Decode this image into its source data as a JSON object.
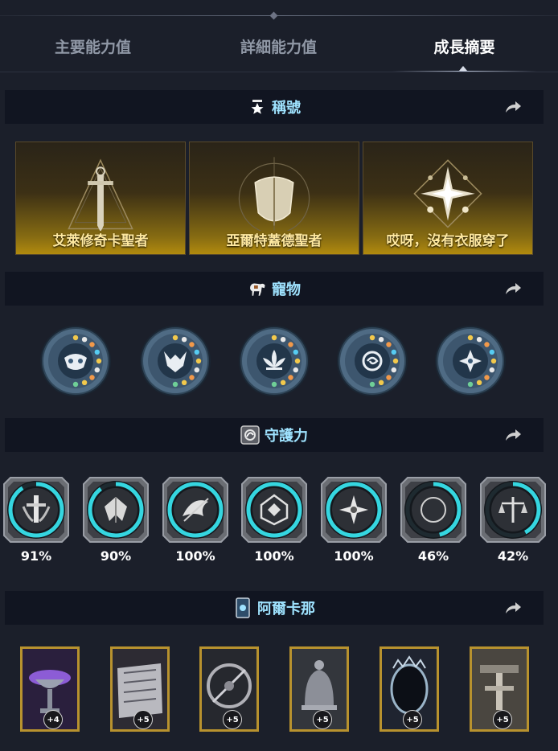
{
  "tabs": [
    {
      "label": "主要能力值",
      "active": false
    },
    {
      "label": "詳細能力值",
      "active": false
    },
    {
      "label": "成長摘要",
      "active": true
    }
  ],
  "sections": {
    "titles": {
      "label": "稱號",
      "icon": "star-medal-icon"
    },
    "pets": {
      "label": "寵物",
      "icon": "horse-icon"
    },
    "guardian": {
      "label": "守護力",
      "icon": "guardian-rune-icon"
    },
    "arkana": {
      "label": "阿爾卡那",
      "icon": "card-icon"
    }
  },
  "titles": [
    {
      "label": "艾萊修奇卡聖者",
      "icon": "sword-triangle-emblem-icon"
    },
    {
      "label": "亞爾特蓋德聖者",
      "icon": "shield-emblem-icon"
    },
    {
      "label": "哎呀，沒有衣服穿了",
      "icon": "compass-star-emblem-icon"
    }
  ],
  "pets": [
    {
      "icon": "owl-mask-pet-icon"
    },
    {
      "icon": "wolf-pet-icon"
    },
    {
      "icon": "lotus-pet-icon"
    },
    {
      "icon": "eye-swirl-pet-icon"
    },
    {
      "icon": "star-flower-pet-icon"
    }
  ],
  "guardians": [
    {
      "percent": 91,
      "label": "91%",
      "icon": "guardian-sword-icon"
    },
    {
      "percent": 90,
      "label": "90%",
      "icon": "guardian-wing-icon"
    },
    {
      "percent": 100,
      "label": "100%",
      "icon": "guardian-bird-icon"
    },
    {
      "percent": 100,
      "label": "100%",
      "icon": "guardian-hex-icon"
    },
    {
      "percent": 100,
      "label": "100%",
      "icon": "guardian-star-icon"
    },
    {
      "percent": 46,
      "label": "46%",
      "icon": "guardian-moon-icon"
    },
    {
      "percent": 42,
      "label": "42%",
      "icon": "guardian-scales-icon"
    }
  ],
  "arkana": [
    {
      "badge": "+4",
      "icon": "chalice-card-icon"
    },
    {
      "badge": "+5",
      "icon": "scroll-card-icon"
    },
    {
      "badge": "+5",
      "icon": "compass-card-icon"
    },
    {
      "badge": "+5",
      "icon": "bell-card-icon"
    },
    {
      "badge": "+5",
      "icon": "mirror-card-icon"
    },
    {
      "badge": "+5",
      "icon": "gate-card-icon"
    }
  ],
  "colors": {
    "accent_cyan": "#9fe3ff",
    "ring_cyan": "#35d6e0",
    "gold": "#b8922e"
  }
}
